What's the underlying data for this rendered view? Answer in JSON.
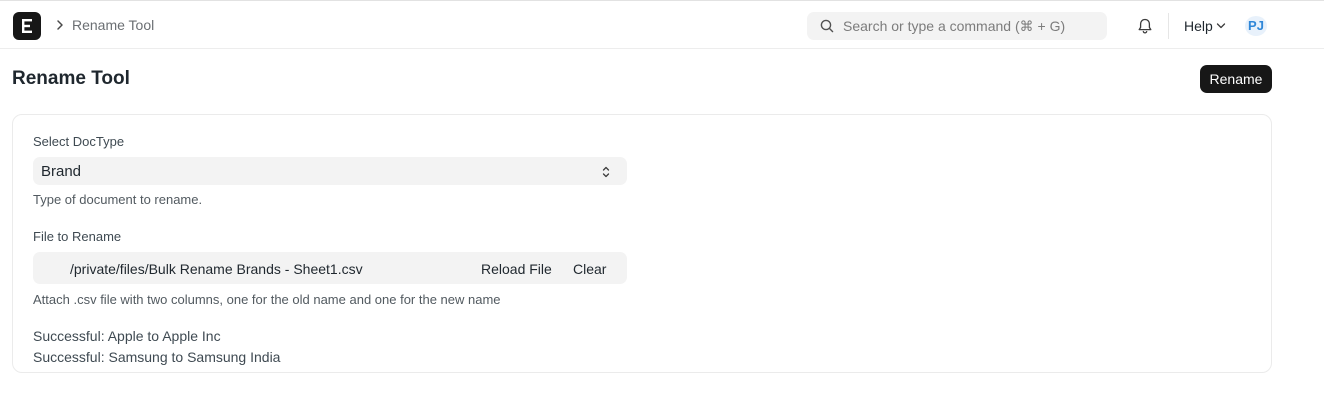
{
  "navbar": {
    "breadcrumb": "Rename Tool",
    "search_placeholder": "Search or type a command (⌘ + G)",
    "help_label": "Help",
    "avatar_initials": "PJ"
  },
  "page": {
    "title": "Rename Tool",
    "primary_action": "Rename"
  },
  "form": {
    "doctype": {
      "label": "Select DocType",
      "value": "Brand",
      "description": "Type of document to rename."
    },
    "file": {
      "label": "File to Rename",
      "value": "/private/files/Bulk Rename Brands - Sheet1.csv",
      "reload_label": "Reload File",
      "clear_label": "Clear",
      "description": "Attach .csv file with two columns, one for the old name and one for the new name"
    },
    "results": [
      "Successful: Apple to Apple Inc",
      "Successful: Samsung to Samsung India"
    ]
  },
  "colors": {
    "primary_button": "#171717",
    "avatar_text": "#2f87d8",
    "input_bg": "#f3f3f3"
  },
  "icons": {
    "logo": "app-logo-icon",
    "search": "search-icon",
    "notifications": "bell-icon",
    "dropdown": "chevron-down-icon",
    "select": "chevron-updown-icon"
  }
}
